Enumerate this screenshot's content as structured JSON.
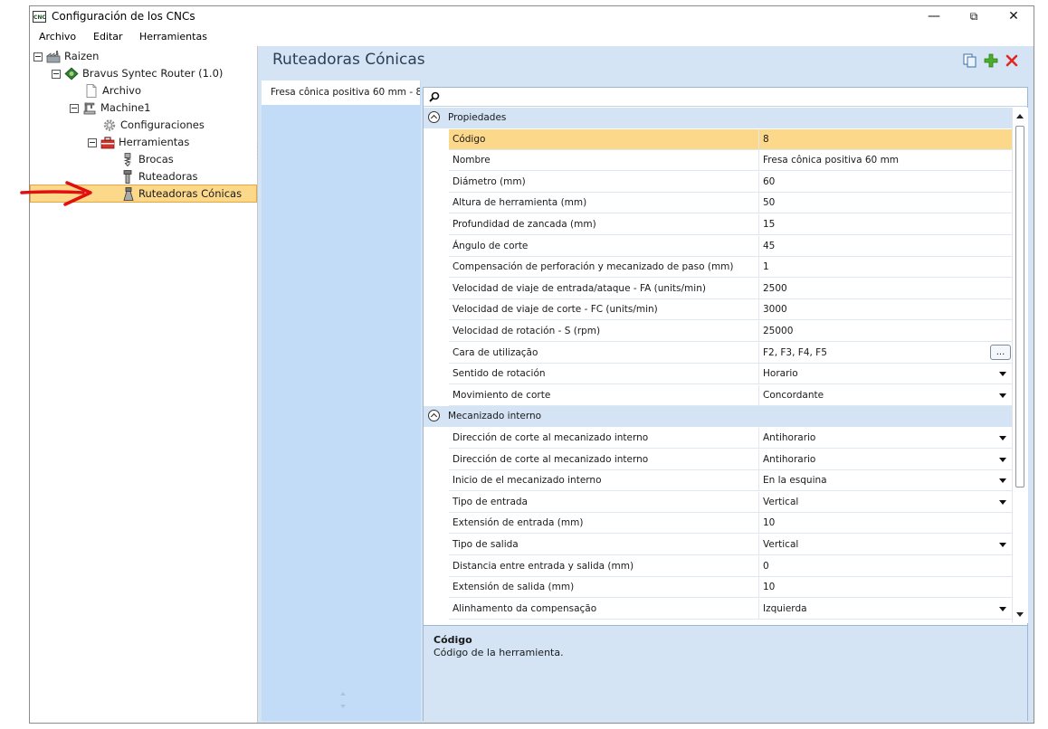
{
  "window": {
    "title": "Configuración de los CNCs",
    "icon": "CNC",
    "controls": {
      "minimize": "—",
      "maximize": "⧉",
      "close": "✕"
    }
  },
  "menu": [
    "Archivo",
    "Editar",
    "Herramientas"
  ],
  "tree": [
    {
      "label": "Raizen",
      "icon": "factory-icon",
      "expanded": true
    },
    {
      "label": "Bravus Syntec Router (1.0)",
      "icon": "router-diamond-icon",
      "expanded": true
    },
    {
      "label": "Archivo",
      "icon": "document-icon"
    },
    {
      "label": "Machine1",
      "icon": "machine-icon",
      "expanded": true
    },
    {
      "label": "Configuraciones",
      "icon": "gear-icon"
    },
    {
      "label": "Herramientas",
      "icon": "toolbox-icon",
      "expanded": true
    },
    {
      "label": "Brocas",
      "icon": "drill-bit-icon"
    },
    {
      "label": "Ruteadoras",
      "icon": "router-bit-icon"
    },
    {
      "label": "Ruteadoras Cónicas",
      "icon": "conical-bit-icon",
      "selected": true
    }
  ],
  "right_panel": {
    "title": "Ruteadoras Cónicas",
    "toolbar_icons": [
      "copy-icon",
      "add-icon",
      "delete-icon"
    ],
    "list_items": [
      "Fresa cônica positiva 60 mm - 8"
    ]
  },
  "search": {
    "icon": "search-icon",
    "value": ""
  },
  "properties": {
    "categories": [
      {
        "label": "Propiedades",
        "rows": [
          {
            "name": "Código",
            "value": "8",
            "selected": true
          },
          {
            "name": "Nombre",
            "value": "Fresa cônica positiva 60 mm"
          },
          {
            "name": "Diámetro (mm)",
            "value": "60"
          },
          {
            "name": "Altura de herramienta (mm)",
            "value": "50"
          },
          {
            "name": "Profundidad de zancada (mm)",
            "value": "15"
          },
          {
            "name": "Ángulo de corte",
            "value": "45"
          },
          {
            "name": "Compensación de perforación y mecanizado de paso (mm)",
            "value": "1"
          },
          {
            "name": "Velocidad de viaje de entrada/ataque - FA (units/min)",
            "value": "2500"
          },
          {
            "name": "Velocidad de viaje de corte - FC (units/min)",
            "value": "3000"
          },
          {
            "name": "Velocidad de rotación - S (rpm)",
            "value": "25000"
          },
          {
            "name": "Cara de utilização",
            "value": "F2, F3, F4, F5",
            "editor": "ellipsis",
            "editor_label": "..."
          },
          {
            "name": "Sentido de rotación",
            "value": "Horario",
            "editor": "dropdown"
          },
          {
            "name": "Movimiento de corte",
            "value": "Concordante",
            "editor": "dropdown"
          }
        ]
      },
      {
        "label": "Mecanizado interno",
        "rows": [
          {
            "name": "Dirección de corte al mecanizado interno",
            "value": "Antihorario",
            "editor": "dropdown"
          },
          {
            "name": "Dirección de corte al mecanizado interno",
            "value": "Antihorario",
            "editor": "dropdown"
          },
          {
            "name": "Inicio de el mecanizado interno",
            "value": "En la esquina",
            "editor": "dropdown"
          },
          {
            "name": "Tipo de entrada",
            "value": "Vertical",
            "editor": "dropdown"
          },
          {
            "name": "Extensión de entrada (mm)",
            "value": "10"
          },
          {
            "name": "Tipo de salida",
            "value": "Vertical",
            "editor": "dropdown"
          },
          {
            "name": "Distancia entre entrada y salida (mm)",
            "value": "0"
          },
          {
            "name": "Extensión de salida (mm)",
            "value": "10"
          },
          {
            "name": "Alinhamento da compensação",
            "value": "Izquierda",
            "editor": "dropdown"
          }
        ]
      }
    ]
  },
  "description": {
    "title": "Código",
    "text": "Código de la herramienta."
  },
  "colors": {
    "selection": "#fcd88a",
    "panel_bg": "#d4e4f5",
    "list_bg": "#c2dcf7",
    "annotation_arrow": "#e01010"
  }
}
